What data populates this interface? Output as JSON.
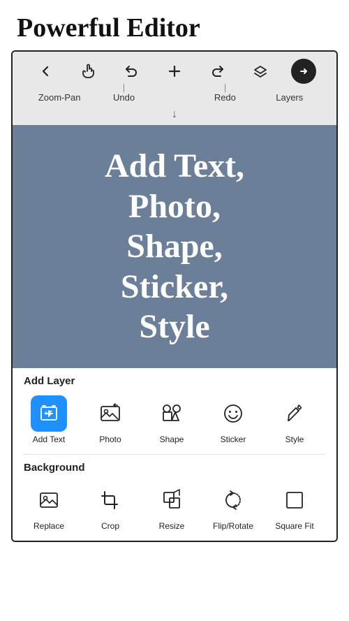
{
  "header": {
    "title": "Powerful Editor"
  },
  "toolbar": {
    "icons": [
      {
        "name": "back-icon",
        "symbol": "←",
        "label": ""
      },
      {
        "name": "pan-icon",
        "symbol": "✋",
        "label": ""
      },
      {
        "name": "undo-icon",
        "symbol": "↩",
        "label": "Undo"
      },
      {
        "name": "add-icon",
        "symbol": "+",
        "label": ""
      },
      {
        "name": "redo-icon",
        "symbol": "↪",
        "label": "Redo"
      },
      {
        "name": "layers-icon",
        "symbol": "⬡",
        "label": "Layers"
      },
      {
        "name": "go-icon",
        "symbol": "→",
        "label": ""
      }
    ],
    "bottom_labels": {
      "zoom_pan": "Zoom-Pan",
      "down_arrow": "↓",
      "layers": "Layers"
    }
  },
  "canvas": {
    "text": "Add Text,\nPhoto,\nShape,\nSticker,\nStyle"
  },
  "add_layer_section": {
    "label": "Add Layer",
    "tools": [
      {
        "name": "add-text-tool",
        "label": "Add Text",
        "icon": "add-text"
      },
      {
        "name": "photo-tool",
        "label": "Photo",
        "icon": "photo"
      },
      {
        "name": "shape-tool",
        "label": "Shape",
        "icon": "shape"
      },
      {
        "name": "sticker-tool",
        "label": "Sticker",
        "icon": "sticker"
      },
      {
        "name": "style-tool",
        "label": "Style",
        "icon": "style"
      }
    ]
  },
  "background_section": {
    "label": "Background",
    "tools": [
      {
        "name": "replace-tool",
        "label": "Replace",
        "icon": "replace"
      },
      {
        "name": "crop-tool",
        "label": "Crop",
        "icon": "crop"
      },
      {
        "name": "resize-tool",
        "label": "Resize",
        "icon": "resize"
      },
      {
        "name": "flip-rotate-tool",
        "label": "Flip/Rotate",
        "icon": "flip-rotate"
      },
      {
        "name": "square-fit-tool",
        "label": "Square Fit",
        "icon": "square-fit"
      }
    ]
  }
}
